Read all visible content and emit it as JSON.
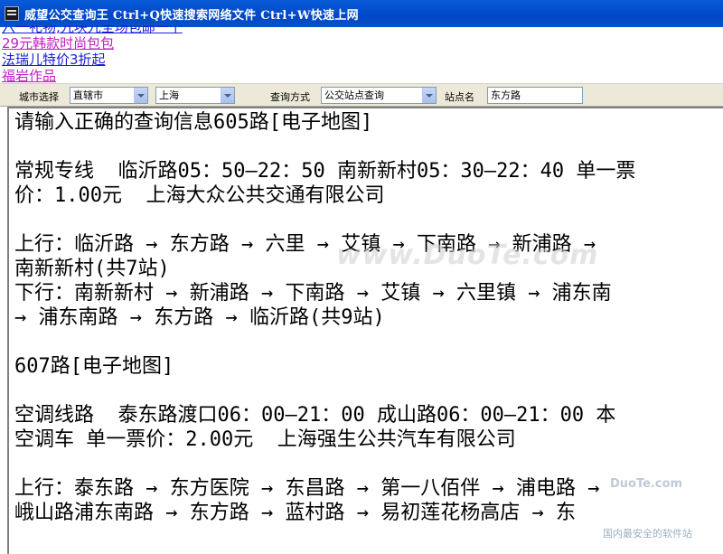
{
  "window": {
    "title": "威望公交查询王  Ctrl+Q快速搜索网络文件  Ctrl+W快速上网"
  },
  "ads": [
    {
      "text": "六一礼物,九块九全场包邮一个"
    },
    {
      "text": "29元韩款时尚包包"
    },
    {
      "text": "法瑞儿特价3折起"
    },
    {
      "text": "福岩作品"
    }
  ],
  "toolbar": {
    "city_label": "城市选择",
    "province_value": "直辖市",
    "city_value": "上海",
    "mode_label": "查询方式",
    "mode_value": "公交站点查询",
    "station_label": "站点名",
    "station_value": "东方路"
  },
  "result": {
    "text": "请输入正确的查询信息605路[电子地图]\n\n常规专线  临沂路05：50—22：50 南新新村05：30—22：40 单一票\n价：1.00元  上海大众公共交通有限公司\n\n上行：临沂路 → 东方路 → 六里 → 艾镇 → 下南路 → 新浦路 →\n南新新村(共7站)\n下行：南新新村 → 新浦路 → 下南路 → 艾镇 → 六里镇 → 浦东南\n→ 浦东南路 → 东方路 → 临沂路(共9站)\n\n607路[电子地图]\n\n空调线路  泰东路渡口06：00—21：00 成山路06：00—21：00 本\n空调车 单一票价：2.00元  上海强生公共汽车有限公司\n\n上行：泰东路 → 东方医院 → 东昌路 → 第一八佰伴 → 浦电路 →\n峨山路浦东南路 → 东方路 → 蓝村路 → 易初莲花杨高店 → 东"
  },
  "watermark": {
    "text": "www.DuoTe.com"
  },
  "badge": {
    "logo": "DuoTe.com",
    "caption": "国内最安全的软件站"
  }
}
